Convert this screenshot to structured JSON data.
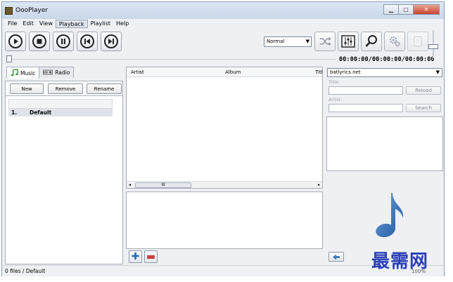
{
  "window": {
    "title": "OooPlayer"
  },
  "menu": [
    "File",
    "Edit",
    "View",
    "Playback",
    "Playlist",
    "Help"
  ],
  "menu_active_index": 3,
  "player": {
    "buttons": [
      "play-icon",
      "stop-icon",
      "pause-icon",
      "previous-icon",
      "next-icon"
    ],
    "mode": "Normal",
    "time": "00:00:00/00:00:00/00:00:00",
    "tool_icons": [
      "shuffle-icon",
      "equalizer-icon",
      "search-icon",
      "settings-icon",
      "notes-icon"
    ]
  },
  "library": {
    "tabs": [
      {
        "label": "Music",
        "icon": "music-note-icon"
      },
      {
        "label": "Radio",
        "icon": "radio-icon"
      }
    ],
    "buttons": {
      "new": "New",
      "remove": "Remove",
      "rename": "Rename"
    },
    "playlists": [
      {
        "index": "1.",
        "name": "Default"
      }
    ]
  },
  "tracks": {
    "columns": [
      "Artist",
      "Album",
      "Titl"
    ],
    "scroll_thumb": "III"
  },
  "lyrics": {
    "source": "batlyrics.net",
    "title_label": "Title:",
    "artist_label": "Artist:",
    "reload_label": "Reload",
    "search_label": "Search"
  },
  "status": {
    "text": "0 files / Default",
    "zoom": "100%"
  },
  "watermark": "最需网",
  "colors": {
    "accent": "#1f5fa8",
    "note": "#2f6db5",
    "add": "#2a6fc0",
    "remove": "#c84040"
  }
}
